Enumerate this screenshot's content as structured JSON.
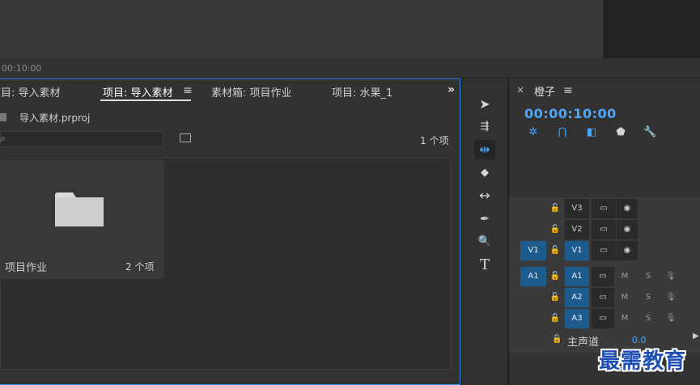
{
  "monitor": {
    "timecode": "00:10:00"
  },
  "project_panel": {
    "tabs": [
      {
        "label": "项目: 导入素材",
        "active": false
      },
      {
        "label": "项目: 导入素材",
        "active": true
      },
      {
        "label": "素材箱: 项目作业",
        "active": false
      },
      {
        "label": "项目: 水果_1",
        "active": false
      }
    ],
    "tab_menu_glyph": "≡",
    "more_tabs_glyph": "»",
    "project_file": "导入素材.prproj",
    "search": {
      "placeholder": ""
    },
    "item_count": "1 个项",
    "bin": {
      "name": "项目作业",
      "count": "2 个项"
    }
  },
  "tools": [
    {
      "name": "selection-tool",
      "glyph": "➤",
      "active": false
    },
    {
      "name": "track-select-tool",
      "glyph": "⇶",
      "active": false
    },
    {
      "name": "ripple-edit-tool",
      "glyph": "⇹",
      "active": true
    },
    {
      "name": "razor-tool",
      "glyph": "◆",
      "active": false
    },
    {
      "name": "slip-tool",
      "glyph": "↔",
      "active": false
    },
    {
      "name": "pen-tool",
      "glyph": "✒",
      "active": false
    },
    {
      "name": "hand-zoom-tool",
      "glyph": "🔍",
      "active": false
    },
    {
      "name": "type-tool",
      "glyph": "T",
      "active": false
    }
  ],
  "timeline": {
    "title": "橙子",
    "menu_glyph": "≡",
    "close_glyph": "×",
    "timecode": "00:00:10:00",
    "tracks": {
      "video": [
        {
          "label": "V3",
          "source": "",
          "active": false
        },
        {
          "label": "V2",
          "source": "",
          "active": false
        },
        {
          "label": "V1",
          "source": "V1",
          "active": true
        }
      ],
      "audio": [
        {
          "label": "A1",
          "source": "A1",
          "mute": "M",
          "solo": "S"
        },
        {
          "label": "A2",
          "source": "",
          "mute": "M",
          "solo": "S"
        },
        {
          "label": "A3",
          "source": "",
          "mute": "M",
          "solo": "S"
        }
      ]
    },
    "master": {
      "label": "主声道",
      "value": "0.0"
    }
  },
  "watermark": "最需教育",
  "colors": {
    "accent": "#2d8ceb",
    "timecode": "#4aa8ff",
    "track_active": "#1d5b8f"
  }
}
